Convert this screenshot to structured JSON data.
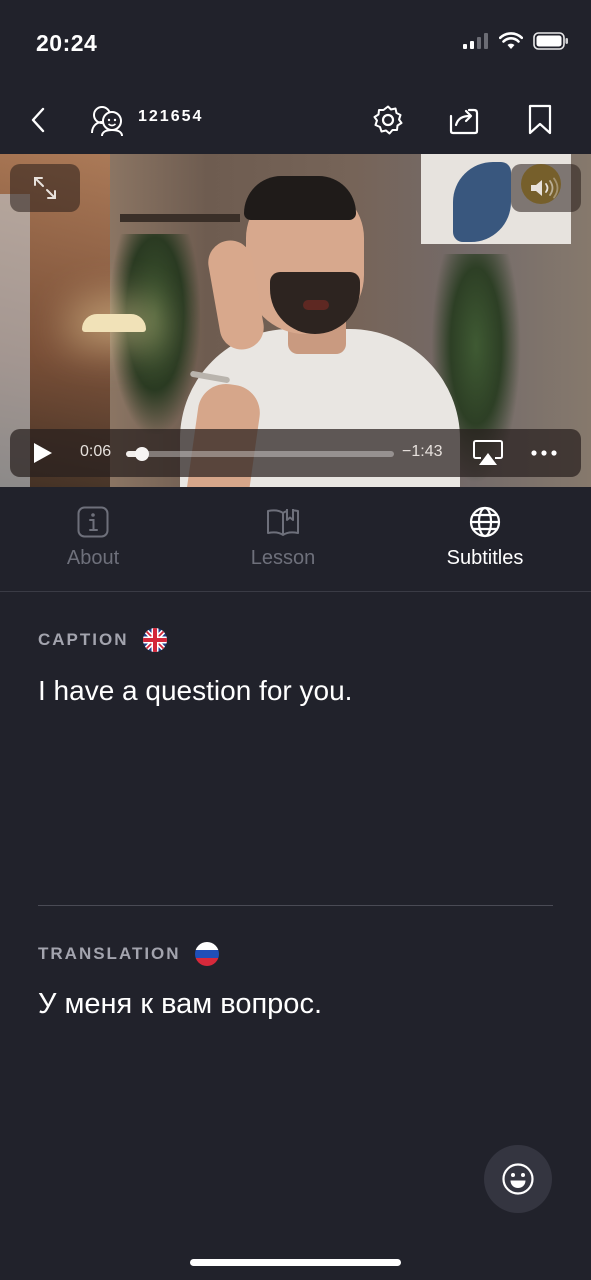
{
  "status_bar": {
    "time": "20:24",
    "icons": [
      "signal-icon",
      "wifi-icon",
      "battery-icon"
    ]
  },
  "nav": {
    "id_label": "121654",
    "icons": [
      "back-icon",
      "avatar-group-icon",
      "settings-icon",
      "share-icon",
      "bookmark-icon"
    ]
  },
  "video": {
    "current_time": "0:06",
    "remaining_time": "−1:43",
    "progress": 0.06,
    "icons": [
      "expand-icon",
      "volume-icon",
      "play-icon",
      "airplay-icon",
      "more-icon"
    ]
  },
  "tabs": [
    {
      "label": "About",
      "icon": "info-icon",
      "active": false
    },
    {
      "label": "Lesson",
      "icon": "book-icon",
      "active": false
    },
    {
      "label": "Subtitles",
      "icon": "globe-icon",
      "active": true
    }
  ],
  "caption": {
    "label": "CAPTION",
    "text": "I have a question for you.",
    "flag": "uk-flag-icon"
  },
  "translation": {
    "label": "TRANSLATION",
    "text": "У меня к вам вопрос.",
    "flag": "russia-flag-icon"
  },
  "fab": {
    "icon": "smiley-icon"
  },
  "colors": {
    "background": "#21222b",
    "inactive_tab": "#6e707b",
    "section_label": "#a3a4ae",
    "fab_bg": "#343540"
  }
}
